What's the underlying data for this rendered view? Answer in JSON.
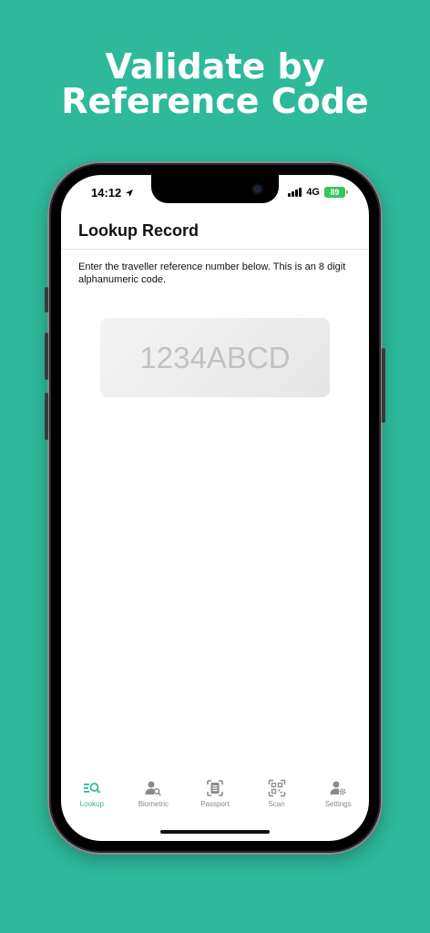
{
  "headline": {
    "line1": "Validate by",
    "line2": "Reference Code"
  },
  "status_bar": {
    "time": "14:12",
    "network": "4G",
    "battery": "89"
  },
  "screen": {
    "title": "Lookup Record",
    "instructions": "Enter the traveller reference number below. This is an 8 digit alphanumeric code.",
    "reference_input": {
      "placeholder": "1234ABCD",
      "value": ""
    }
  },
  "tabs": [
    {
      "label": "Lookup",
      "icon": "lookup-search-icon",
      "active": true
    },
    {
      "label": "Biometric",
      "icon": "user-search-icon",
      "active": false
    },
    {
      "label": "Passport",
      "icon": "passport-icon",
      "active": false
    },
    {
      "label": "Scan",
      "icon": "qr-scan-icon",
      "active": false
    },
    {
      "label": "Settings",
      "icon": "user-settings-icon",
      "active": false
    }
  ],
  "colors": {
    "accent": "#2db99a",
    "inactive": "#8a8a8a",
    "battery": "#34c759"
  }
}
